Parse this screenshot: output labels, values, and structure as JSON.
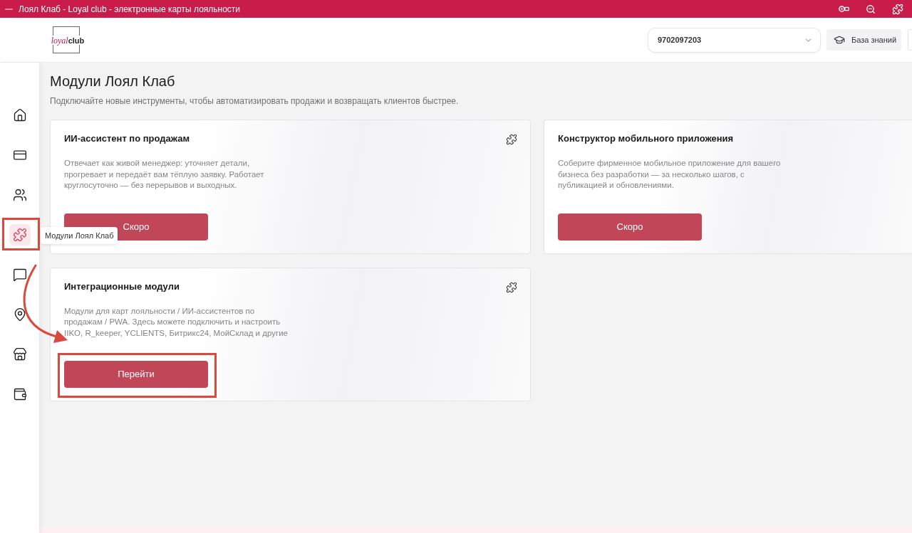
{
  "window": {
    "title": "Лоял Клаб - Loyal club - электронные карты лояльности"
  },
  "header": {
    "logo": {
      "accent": "loyal",
      "text": "club"
    },
    "account_select": {
      "value": "9702097203"
    },
    "knowledge_button": {
      "label": "База знаний"
    }
  },
  "sidebar": {
    "items": [
      {
        "selected": false,
        "highlighted": false
      },
      {
        "selected": false,
        "highlighted": false
      },
      {
        "selected": false,
        "highlighted": false
      },
      {
        "selected": true,
        "highlighted": true
      },
      {
        "selected": false,
        "highlighted": false
      },
      {
        "selected": false,
        "highlighted": false
      },
      {
        "selected": false,
        "highlighted": false
      },
      {
        "selected": false,
        "highlighted": false
      }
    ],
    "tooltip": "Модули Лоял Клаб"
  },
  "page": {
    "title": "Модули Лоял Клаб",
    "subtitle": "Подключайте новые инструменты, чтобы автоматизировать продажи и возвращать клиентов быстрее."
  },
  "modules": [
    {
      "title": "ИИ-ассистент по продажам",
      "description": "Отвечает как живой менеджер: уточняет детали,\nпрогревает и передаёт вам тёплую заявку. Работает\nкруглосуточно — без перерывов и выходных.",
      "button": "Скоро",
      "icon_shown": true,
      "highlighted": false
    },
    {
      "title": "Конструктор мобильного приложения",
      "description": "Соберите фирменное мобильное приложение для вашего\nбизнеса без разработки — за несколько шагов, с\nпубликацией и обновлениями.",
      "button": "Скоро",
      "icon_shown": false,
      "highlighted": false
    },
    {
      "title": "Интеграционные модули",
      "description": "Модули для карт лояльности / ИИ-ассистентов по\nпродажам / PWA. Здесь можете подключить и настроить\nIIKO, R_keeper, YCLIENTS, Битрикс24, МойСклад и другие",
      "button": "Перейти",
      "icon_shown": true,
      "highlighted": true
    }
  ]
}
